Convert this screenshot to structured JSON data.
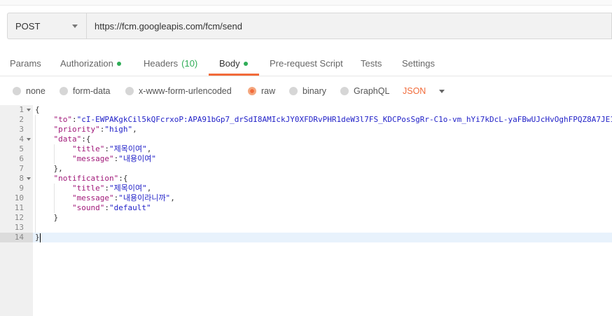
{
  "request": {
    "method": "POST",
    "url": "https://fcm.googleapis.com/fcm/send"
  },
  "tabs": [
    {
      "label": "Params"
    },
    {
      "label": "Authorization",
      "dot": true
    },
    {
      "label": "Headers",
      "count": "(10)"
    },
    {
      "label": "Body",
      "dot": true,
      "active": true
    },
    {
      "label": "Pre-request Script"
    },
    {
      "label": "Tests"
    },
    {
      "label": "Settings"
    }
  ],
  "body_types": {
    "options": [
      "none",
      "form-data",
      "x-www-form-urlencoded",
      "raw",
      "binary",
      "GraphQL"
    ],
    "selected": "raw",
    "format": "JSON"
  },
  "editor": {
    "lines": [
      {
        "n": "1",
        "text": "{"
      },
      {
        "n": "2",
        "key": "\"to\"",
        "value": "\"cI-EWPAKgkCil5kQFcrxoP:APA91bGp7_drSdI8AMIckJY0XFDRvPHR1deW3l7FS_KDCPosSgRr-C1o-vm_hYi7kDcL-yaFBwUJcHvOghFPQZ8A7JE1"
      },
      {
        "n": "3",
        "key": "\"priority\"",
        "value": "\"high\""
      },
      {
        "n": "4",
        "key": "\"data\"",
        "text": ":{"
      },
      {
        "n": "5",
        "key": "\"title\"",
        "value": "\"제목이여\""
      },
      {
        "n": "6",
        "key": "\"message\"",
        "value": "\"내용이여\""
      },
      {
        "n": "7",
        "text": "},"
      },
      {
        "n": "8",
        "key": "\"notification\"",
        "text": ":{"
      },
      {
        "n": "9",
        "key": "\"title\"",
        "value": "\"제목이여\""
      },
      {
        "n": "10",
        "key": "\"message\"",
        "value": "\"내용이라니까\""
      },
      {
        "n": "11",
        "key": "\"sound\"",
        "value": "\"default\""
      },
      {
        "n": "12",
        "text": "}"
      },
      {
        "n": "13",
        "text": ""
      },
      {
        "n": "14",
        "text": "}"
      }
    ]
  },
  "colors": {
    "accent": "#f26b3a",
    "status_green": "#2fad57",
    "json_key": "#a11a7a",
    "json_string": "#2222c8"
  }
}
